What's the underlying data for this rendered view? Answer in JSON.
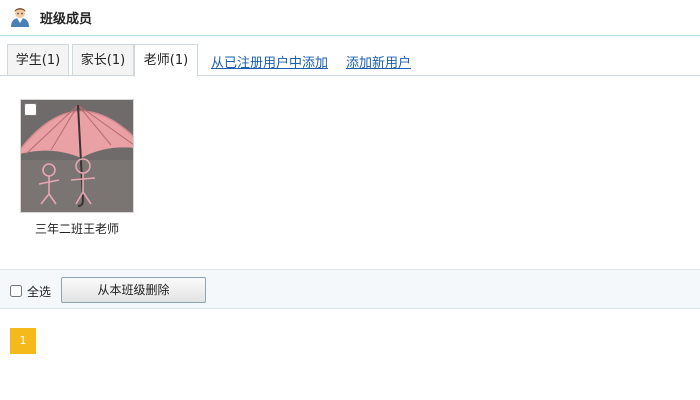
{
  "header": {
    "title": "班级成员",
    "icon": "user-avatar-icon"
  },
  "tabs": [
    {
      "label": "学生(1)",
      "active": false
    },
    {
      "label": "家长(1)",
      "active": false
    },
    {
      "label": "老师(1)",
      "active": true
    }
  ],
  "links": [
    {
      "label": "从已注册用户中添加"
    },
    {
      "label": "添加新用户"
    }
  ],
  "members": [
    {
      "name": "三年二班王老师",
      "photo": "umbrella-photo",
      "checked": false
    }
  ],
  "actions": {
    "select_all_label": "全选",
    "remove_label": "从本班级删除"
  },
  "pagination": {
    "current_page": "1"
  },
  "colors": {
    "accent_link": "#1a5fb4",
    "page_badge": "#f5b91c",
    "header_rule": "#b9dbe8"
  }
}
